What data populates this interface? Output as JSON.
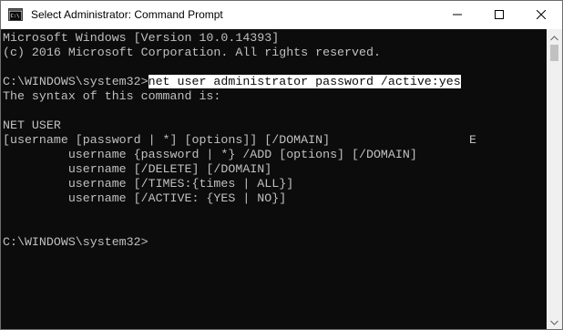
{
  "window": {
    "title": "Select Administrator: Command Prompt",
    "app_icon": "cmd-icon"
  },
  "controls": {
    "minimize": "minimize-icon",
    "maximize": "maximize-icon",
    "close": "close-icon"
  },
  "console": {
    "lines": [
      "Microsoft Windows [Version 10.0.14393]",
      "(c) 2016 Microsoft Corporation. All rights reserved.",
      "",
      "The syntax of this command is:",
      "",
      "NET USER",
      "[username [password | *] [options]] [/DOMAIN]",
      "         username {password | *} /ADD [options] [/DOMAIN]",
      "         username [/DELETE] [/DOMAIN]",
      "         username [/TIMES:{times | ALL}]",
      "         username [/ACTIVE: {YES | NO}]",
      "",
      "",
      "C:\\WINDOWS\\system32>"
    ],
    "prompt": "C:\\WINDOWS\\system32>",
    "selected_command": "net user administrator password /active:yes",
    "stray_char": "E"
  },
  "colors": {
    "console_bg": "#0c0c0c",
    "console_fg": "#c0c0c0",
    "selection_bg": "#ffffff"
  }
}
